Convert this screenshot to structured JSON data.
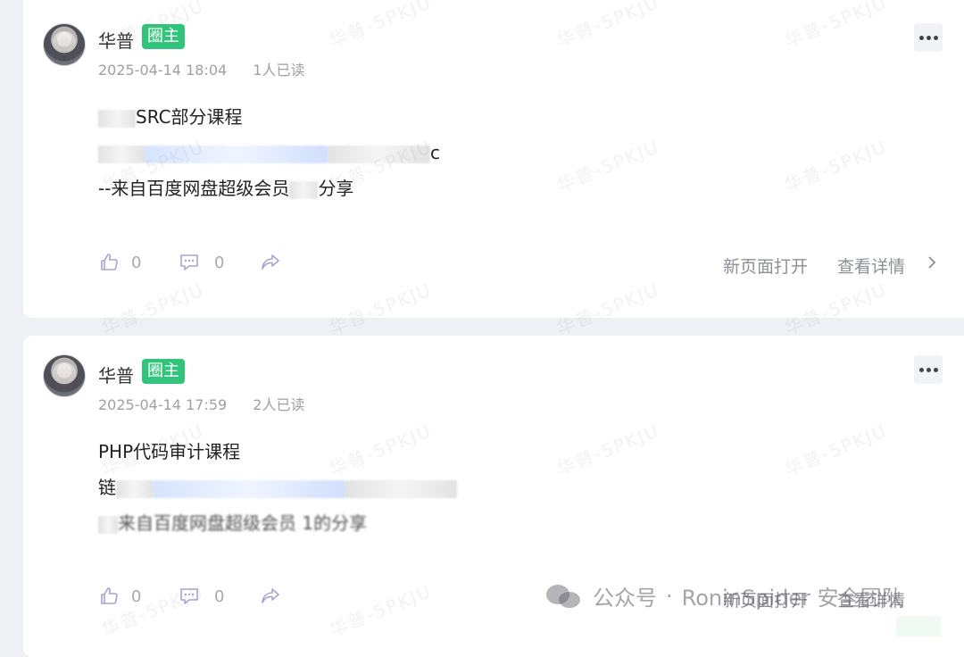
{
  "watermark_text": "华普-5PKJU",
  "posts": [
    {
      "author": "华普",
      "badge": "圈主",
      "date": "2025-04-14 18:04",
      "reads": "1人已读",
      "content": {
        "title_suffix": "SRC部分课程",
        "line2_suffix": "c",
        "line3_prefix": "--来自百度网盘超级会员",
        "line3_suffix": "分享"
      },
      "likes": "0",
      "comments": "0",
      "open_new_page": "新页面打开",
      "view_details": "查看详情"
    },
    {
      "author": "华普",
      "badge": "圈主",
      "date": "2025-04-14 17:59",
      "reads": "2人已读",
      "content": {
        "title": "PHP代码审计课程",
        "line2_prefix": "链",
        "line3_text": "来自百度网盘超级会员 1的分享"
      },
      "likes": "0",
      "comments": "0",
      "open_new_page": "新页面打开",
      "view_details": "查看详情"
    }
  ],
  "footer_watermark": {
    "brand": "公众号",
    "separator": "·",
    "team": "RoninSpider 安全团队"
  }
}
